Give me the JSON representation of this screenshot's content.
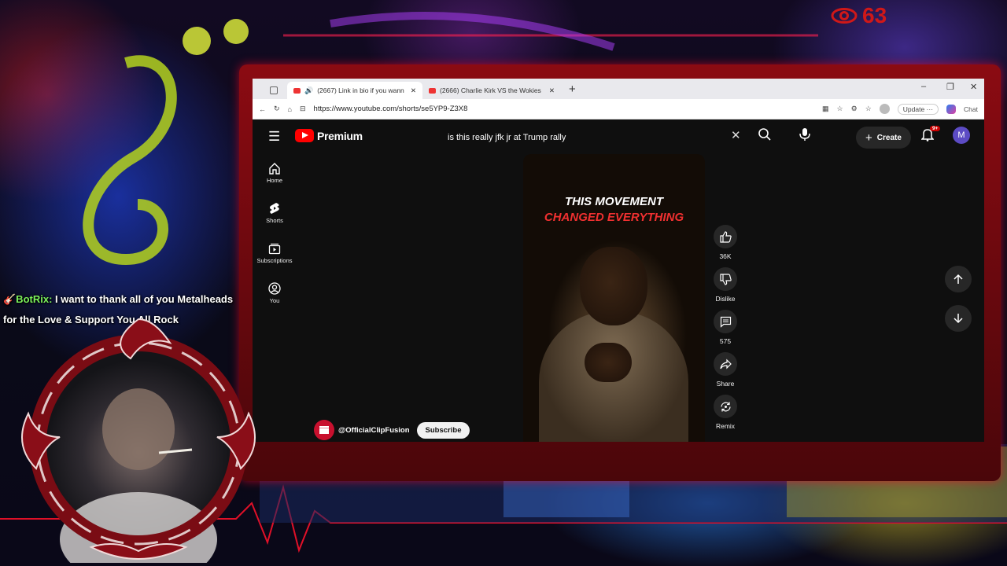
{
  "overlay": {
    "viewer_count": "63",
    "chat": {
      "user": "🎸BotRix: ",
      "text": "I want to thank all of you Metalheads for the Love & Support You All Rock"
    }
  },
  "browser": {
    "tabs": [
      {
        "title": "(2667) Link in bio if you wann"
      },
      {
        "title": "(2666) Charlie Kirk VS the Wokies"
      }
    ],
    "url": "https://www.youtube.com/shorts/se5YP9-Z3X8",
    "update_label": "Update ···",
    "chat_label": "Chat"
  },
  "youtube": {
    "logo_text": "Premium",
    "search_query": "is this really jfk jr at Trump rally",
    "create_label": "Create",
    "notification_badge": "9+",
    "avatar_letter": "M",
    "sidebar": [
      "Home",
      "Shorts",
      "Subscriptions",
      "You"
    ],
    "video": {
      "caption_1": "THIS MOVEMENT",
      "caption_2": "CHANGED EVERYTHING"
    },
    "actions": {
      "likes": "36K",
      "dislike_label": "Dislike",
      "comments": "575",
      "share_label": "Share",
      "remix_label": "Remix"
    },
    "channel": {
      "handle": "@OfficialClipFusion",
      "subscribe_label": "Subscribe"
    }
  },
  "colors": {
    "frame_red": "#8b0b12",
    "youtube_red": "#ff0000",
    "viewer_red": "#d01818",
    "chat_user_green": "#7cf25a",
    "caption_red": "#f03030"
  }
}
